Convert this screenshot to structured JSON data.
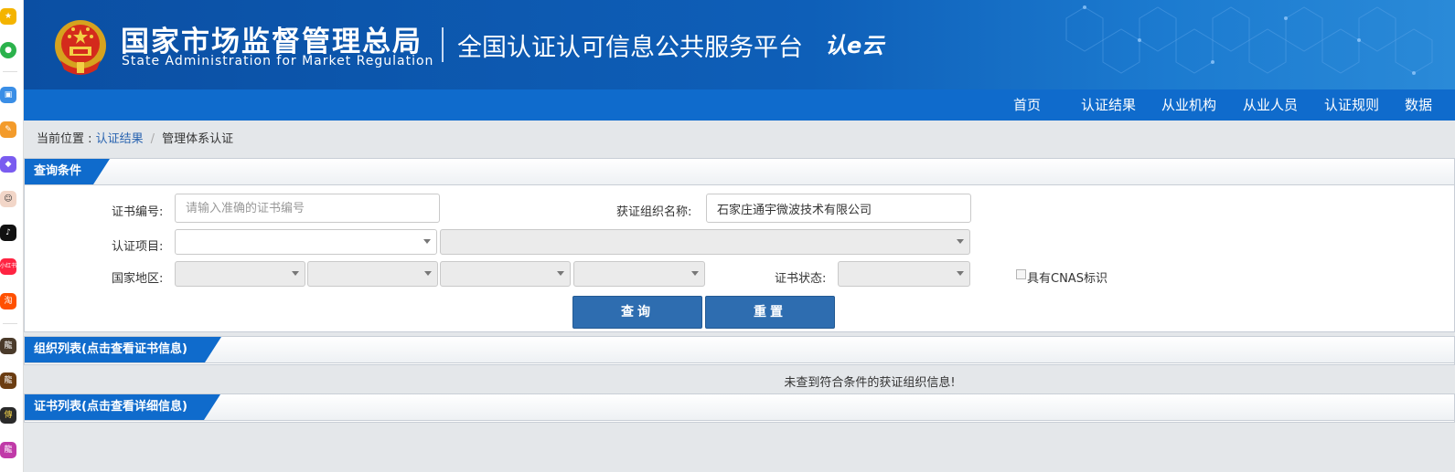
{
  "header": {
    "title_cn": "国家市场监督管理总局",
    "title_en": "State Administration  for  Market Regulation",
    "platform_title": "全国认证认可信息公共服务平台",
    "logo_text": "认e云"
  },
  "nav": {
    "items": [
      "首页",
      "认证结果",
      "从业机构",
      "从业人员",
      "认证规则",
      "数据"
    ]
  },
  "breadcrumb": {
    "prefix": "当前位置 : ",
    "link": "认证结果",
    "separator": "/",
    "current": "管理体系认证"
  },
  "query": {
    "section_title": "查询条件",
    "cert_no_label": "证书编号:",
    "cert_no_placeholder": "请输入准确的证书编号",
    "cert_no_value": "",
    "org_name_label": "获证组织名称:",
    "org_name_value": "石家庄通宇微波技术有限公司",
    "project_label": "认证项目:",
    "region_label": "国家地区:",
    "status_label": "证书状态:",
    "cnas_label": "具有CNAS标识",
    "search_button": "查询",
    "reset_button": "重置"
  },
  "org_list": {
    "section_title": "组织列表(点击查看证书信息)",
    "empty_message": "未查到符合条件的获证组织信息!"
  },
  "cert_list": {
    "section_title": "证书列表(点击查看详细信息)"
  },
  "sidebar": {
    "icons": [
      "star-icon",
      "chat-icon",
      "briefcase-icon",
      "pen-icon",
      "gamepad-icon",
      "avatar-icon",
      "tiktok-icon",
      "xiaohongshu-icon",
      "taobao-icon",
      "game-icon",
      "game-icon",
      "game-icon",
      "game-icon"
    ],
    "xiaohongshu_text": "小红书",
    "taobao_text": "淘"
  },
  "colors": {
    "header_blue": "#0b4fa3",
    "nav_blue": "#0f6bcc",
    "button_blue": "#2e6db0"
  }
}
